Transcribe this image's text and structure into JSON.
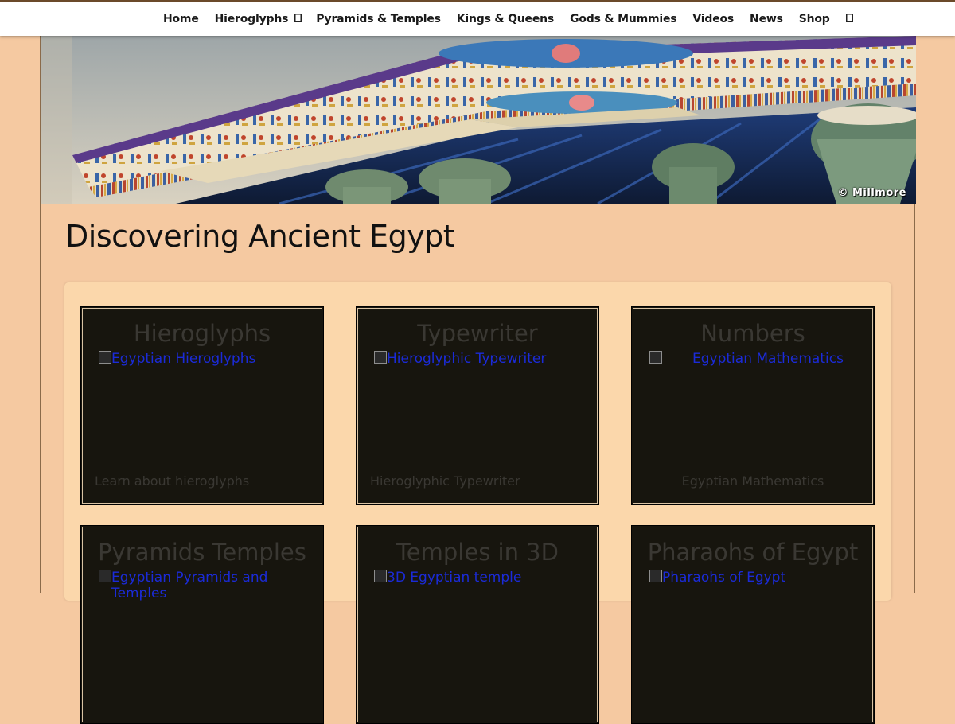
{
  "nav": {
    "items": [
      {
        "label": "Home"
      },
      {
        "label": "Hieroglyphs"
      },
      {
        "label": "Pyramids & Temples"
      },
      {
        "label": "Kings & Queens"
      },
      {
        "label": "Gods & Mummies"
      },
      {
        "label": "Videos"
      },
      {
        "label": "News"
      },
      {
        "label": "Shop"
      }
    ],
    "dropdown_icon": "chevron-down-icon",
    "search_icon": "search-icon"
  },
  "banner": {
    "credit": "© Millmore"
  },
  "page": {
    "title": "Discovering Ancient Egypt"
  },
  "cards": [
    {
      "title": "Hieroglyphs",
      "image_alt": "Egyptian Hieroglyphs",
      "caption": "Learn about hieroglyphs"
    },
    {
      "title": "Typewriter",
      "image_alt": "Hieroglyphic Typewriter",
      "caption": "Hieroglyphic Typewriter"
    },
    {
      "title": "Numbers",
      "image_alt": "Egyptian Mathematics",
      "caption": "Egyptian Mathematics"
    },
    {
      "title": "Pyramids Temples",
      "image_alt": "Egyptian Pyramids and Temples",
      "caption": ""
    },
    {
      "title": "Temples in 3D",
      "image_alt": "3D Egyptian temple",
      "caption": ""
    },
    {
      "title": "Pharaohs of Egypt",
      "image_alt": "Pharaohs of Egypt",
      "caption": ""
    }
  ],
  "colors": {
    "background": "#f5c9a1",
    "panel": "#fbd7ab",
    "card": "#17150e",
    "link": "#1b2bd8"
  }
}
